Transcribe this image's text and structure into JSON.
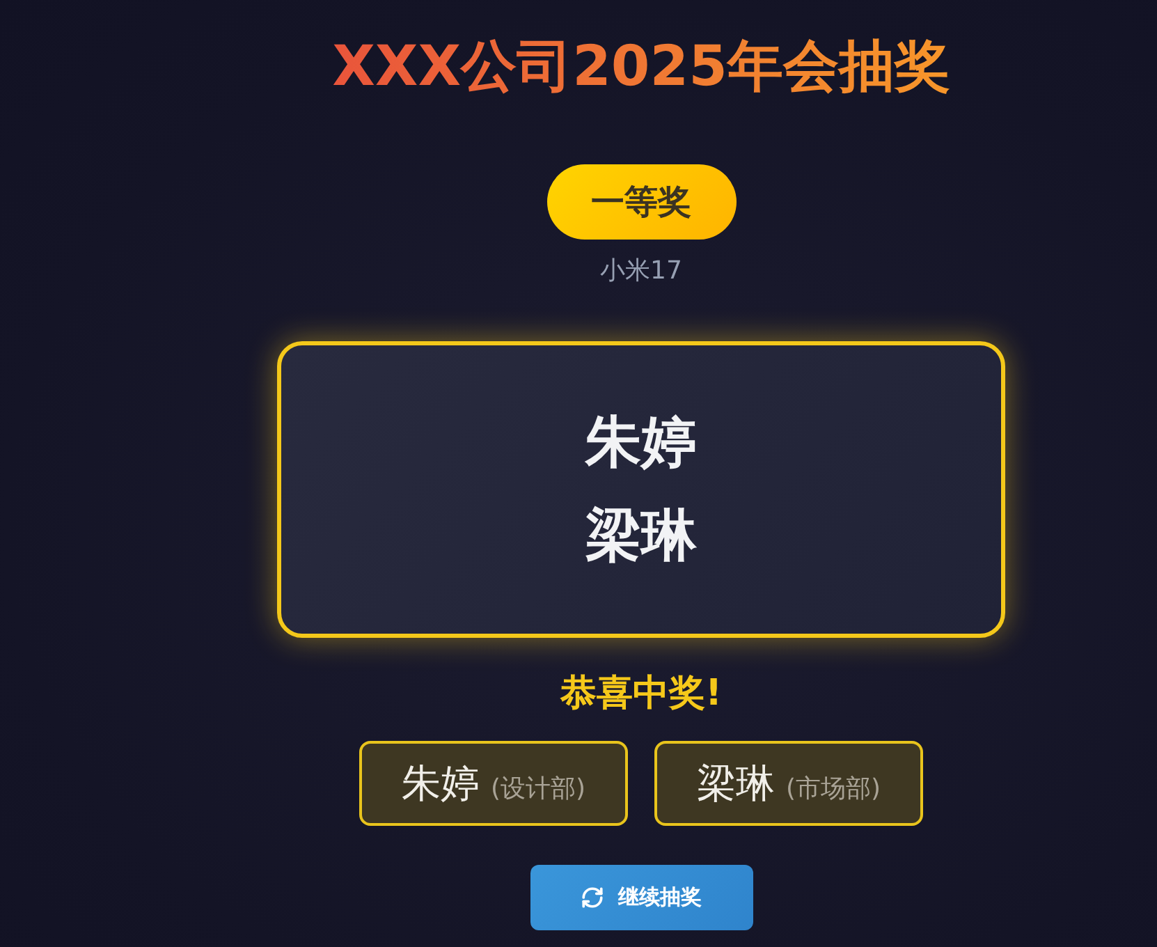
{
  "title": "XXX公司2025年会抽奖",
  "prize": {
    "badge": "一等奖",
    "name": "小米17"
  },
  "draw_display": {
    "names": [
      "朱婷",
      "梁琳"
    ]
  },
  "result": {
    "heading": "恭喜中奖!",
    "winners": [
      {
        "name": "朱婷",
        "department": "(设计部)"
      },
      {
        "name": "梁琳",
        "department": "(市场部)"
      }
    ]
  },
  "action_button": {
    "label": "继续抽奖"
  }
}
